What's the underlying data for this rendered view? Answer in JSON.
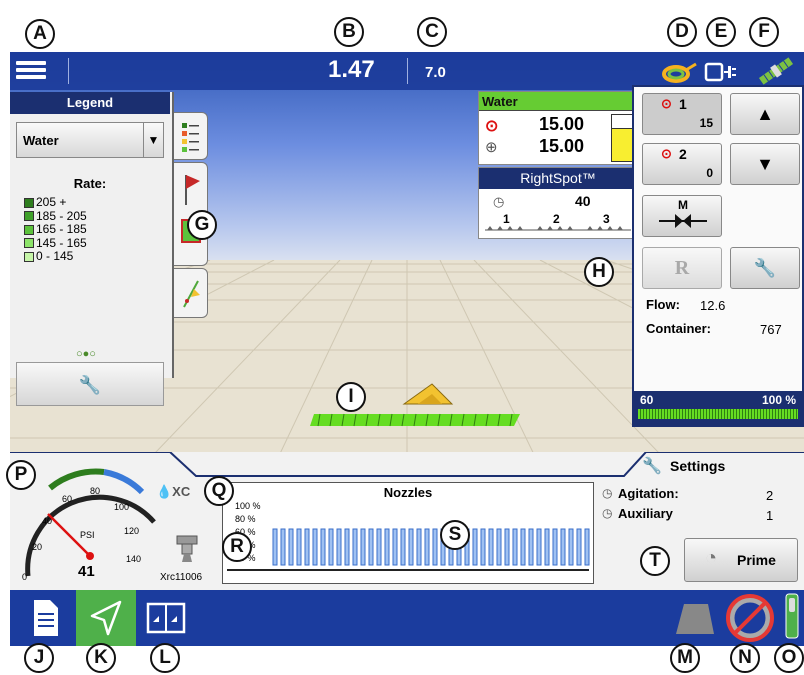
{
  "callouts": [
    "A",
    "B",
    "C",
    "D",
    "E",
    "F",
    "G",
    "H",
    "I",
    "J",
    "K",
    "L",
    "M",
    "N",
    "O",
    "P",
    "Q",
    "R",
    "S",
    "T"
  ],
  "topbar": {
    "speed": "1.47",
    "value": "7.0"
  },
  "legend": {
    "title": "Legend",
    "product": "Water",
    "rate_label": "Rate:",
    "ranges": [
      {
        "label": "205 +",
        "color": "#2e7d1e"
      },
      {
        "label": "185 - 205",
        "color": "#3fa02a"
      },
      {
        "label": "165 - 185",
        "color": "#5cc23c"
      },
      {
        "label": "145 - 165",
        "color": "#8de46a"
      },
      {
        "label": "0 - 145",
        "color": "#c6f5a8"
      }
    ],
    "dots": "○●○"
  },
  "water": {
    "title": "Water",
    "target": "15.00",
    "actual": "15.00"
  },
  "rightspot": {
    "title": "RightSpot™",
    "value": "40",
    "sections": [
      "1",
      "2",
      "3"
    ]
  },
  "control": {
    "rate1_label": "1",
    "rate1_value": "15",
    "rate2_label": "2",
    "rate2_value": "0",
    "manual_label": "M",
    "rx_label": "R",
    "flow_label": "Flow:",
    "flow_value": "12.6",
    "container_label": "Container:",
    "container_value": "767",
    "bar_left": "60",
    "bar_right": "100 %"
  },
  "gauge": {
    "unit": "PSI",
    "value": "41",
    "ticks": [
      "0",
      "20",
      "40",
      "60",
      "80",
      "100",
      "120",
      "140"
    ]
  },
  "nozzle": {
    "name": "Xrc11006",
    "chart_title": "Nozzles",
    "y_ticks": [
      "100 %",
      "80 %",
      "60 %",
      "40 %",
      "20 %"
    ]
  },
  "settings": {
    "title": "Settings",
    "agitation_label": "Agitation:",
    "agitation_value": "2",
    "auxiliary_label": "Auxiliary",
    "auxiliary_value": "1",
    "prime_label": "Prime"
  },
  "colors": {
    "accent": "#1b2f70",
    "taskbar": "#1b3c9e",
    "active_tab": "#4fb04a",
    "boom": "#66dd22",
    "implement": "#f2c230"
  }
}
